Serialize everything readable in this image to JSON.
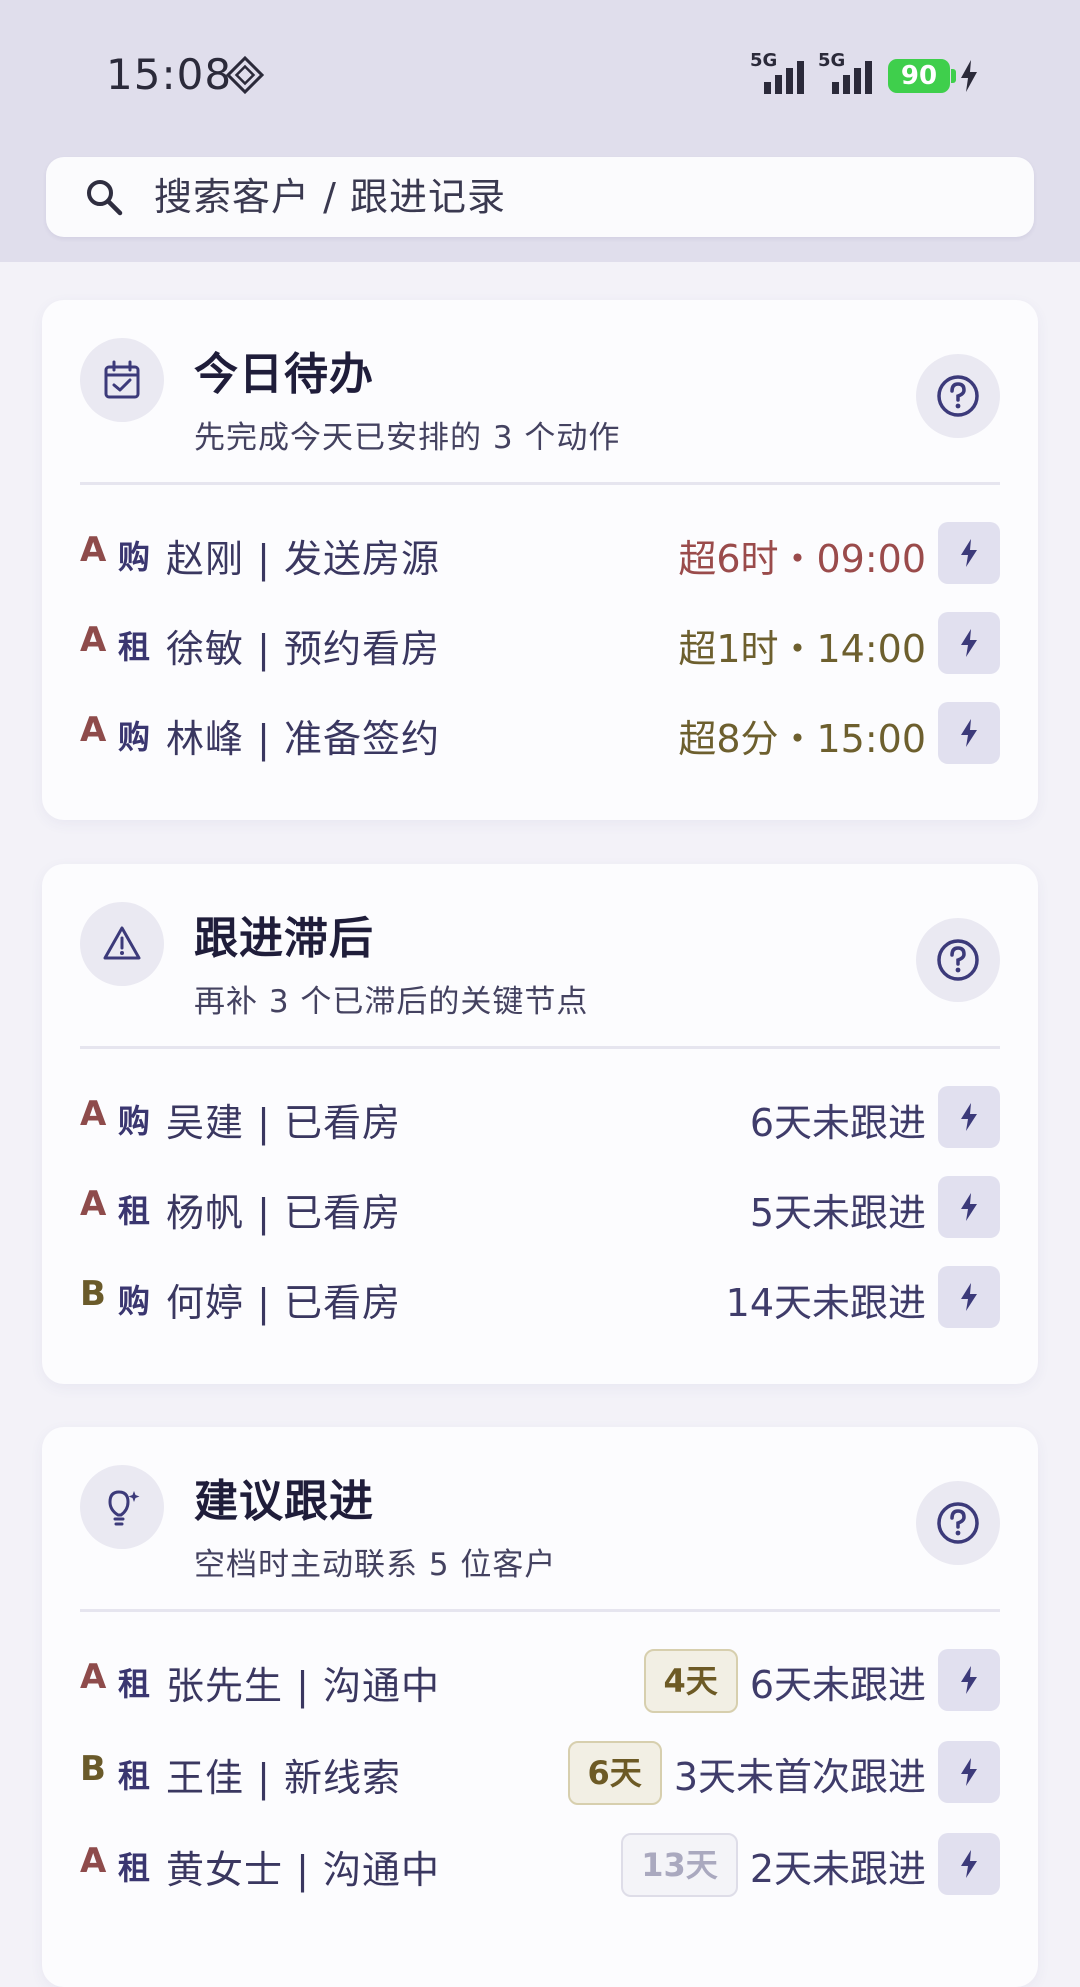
{
  "status_bar": {
    "time": "15:08",
    "signal1_label": "5G",
    "signal2_label": "5G",
    "battery_level": "90"
  },
  "search": {
    "placeholder": "搜索客户 / 跟进记录"
  },
  "today": {
    "title": "今日待办",
    "subtitle": "先完成今天已安排的 3 个动作",
    "items": [
      {
        "grade": "A",
        "type": "购",
        "name": "赵刚 | 发送房源",
        "time": "超6时・09:00"
      },
      {
        "grade": "A",
        "type": "租",
        "name": "徐敏 | 预约看房",
        "time": "超1时・14:00"
      },
      {
        "grade": "A",
        "type": "购",
        "name": "林峰 | 准备签约",
        "time": "超8分・15:00"
      }
    ]
  },
  "overdue": {
    "title": "跟进滞后",
    "subtitle": "再补 3 个已滞后的关键节点",
    "items": [
      {
        "grade": "A",
        "type": "购",
        "name": "吴建 | 已看房",
        "status": "6天未跟进"
      },
      {
        "grade": "A",
        "type": "租",
        "name": "杨帆 | 已看房",
        "status": "5天未跟进"
      },
      {
        "grade": "B",
        "type": "购",
        "name": "何婷 | 已看房",
        "status": "14天未跟进"
      }
    ]
  },
  "suggest": {
    "title": "建议跟进",
    "subtitle": "空档时主动联系 5 位客户",
    "items": [
      {
        "grade": "A",
        "type": "租",
        "name": "张先生 | 沟通中",
        "badge": "4天",
        "status": "6天未跟进"
      },
      {
        "grade": "B",
        "type": "租",
        "name": "王佳 | 新线索",
        "badge": "6天",
        "status": "3天未首次跟进"
      },
      {
        "grade": "A",
        "type": "租",
        "name": "黄女士 | 沟通中",
        "badge": "13天",
        "status": "2天未跟进"
      }
    ]
  },
  "colors": {
    "grade_A": "#8e4b4b",
    "grade_B": "#6a5a2a",
    "accent": "#3c3a7a",
    "battery": "#3fcf4c"
  },
  "icons": {
    "today": "calendar-check-icon",
    "overdue": "warning-triangle-icon",
    "suggest": "lightbulb-icon",
    "help": "help-circle-icon",
    "action": "lightning-icon"
  }
}
